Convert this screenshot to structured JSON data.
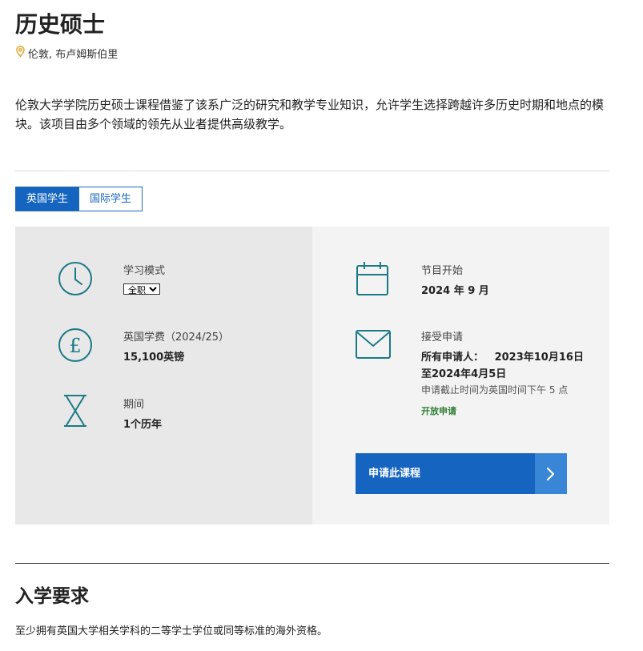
{
  "page": {
    "title": "历史硕士",
    "location": "伦敦, 布卢姆斯伯里",
    "intro": "伦敦大学学院历史硕士课程借鉴了该系广泛的研究和教学专业知识，允许学生选择跨越许多历史时期和地点的模块。该项目由多个领域的领先从业者提供高级教学。"
  },
  "tabs": [
    {
      "label": "英国学生",
      "active": true
    },
    {
      "label": "国际学生",
      "active": false
    }
  ],
  "details": {
    "study_mode": {
      "label": "学习模式",
      "selected": "全职",
      "icon": "clock-icon"
    },
    "fee": {
      "label": "英国学费（2024/25）",
      "value": "15,100英镑",
      "icon": "pound-icon"
    },
    "duration": {
      "label": "期间",
      "value": "1个历年",
      "icon": "hourglass-icon"
    },
    "start": {
      "label": "节目开始",
      "value": "2024 年 9 月",
      "icon": "calendar-icon"
    },
    "applications": {
      "label": "接受申请",
      "line1": "所有申请人：   2023年10月16日",
      "line2": "至2024年4月5日",
      "note": "申请截止时间为英国时间下午 5 点",
      "status": "开放申请",
      "icon": "envelope-icon"
    }
  },
  "apply_button": {
    "label": "申请此课程",
    "icon": "chevron-right-icon"
  },
  "entry": {
    "heading": "入学要求",
    "text": "至少拥有英国大学相关学科的二等学士学位或同等标准的海外资格。"
  },
  "colors": {
    "accent": "#1565c0",
    "icon_teal": "#1b7a86",
    "status_green": "#2e7d32",
    "location_pin": "#e0a020"
  }
}
